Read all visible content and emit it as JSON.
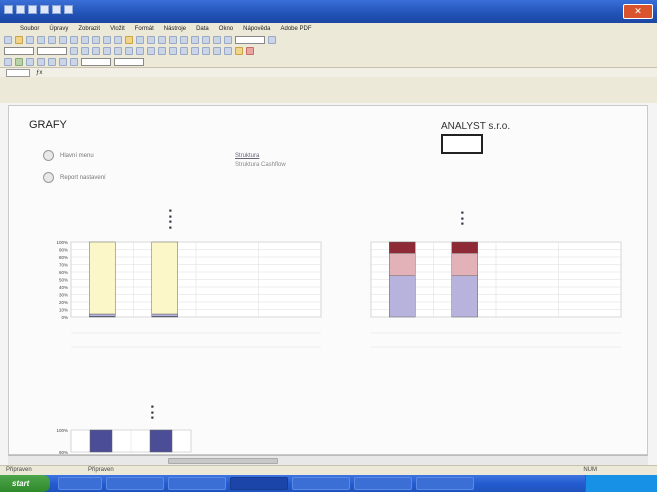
{
  "window": {
    "title": ""
  },
  "menu": {
    "items": [
      "Soubor",
      "Úpravy",
      "Zobrazit",
      "Vložit",
      "Formát",
      "Nástroje",
      "Data",
      "Okno",
      "Nápověda",
      "Adobe PDF"
    ],
    "help_hint": ""
  },
  "formula_bar": {
    "name_box": "",
    "value": ""
  },
  "sheet": {
    "title": "GRAFY",
    "company": "ANALYST s.r.o.",
    "radios": [
      "Hlavní menu",
      "Report nastavení"
    ],
    "links": [
      "Struktura",
      "Struktura Cashflow"
    ]
  },
  "status": {
    "left": "Připraven",
    "mid": "Připraven",
    "right": "NUM"
  },
  "taskbar": {
    "start": "start",
    "tasks": [
      "",
      "",
      "",
      "",
      "",
      ""
    ],
    "clock": ""
  },
  "colors": {
    "bar_yellow": "#fbf7c8",
    "bar_navy": "#4b4d97",
    "bar_red": "#8e2a36",
    "bar_lavender": "#b7b3dc",
    "bar_pink": "#e3b2b9"
  },
  "chart_data": [
    {
      "type": "bar",
      "title": "",
      "legend": [
        "",
        "",
        "",
        ""
      ],
      "yticks": [
        "100%",
        "90%",
        "80%",
        "70%",
        "60%",
        "50%",
        "40%",
        "30%",
        "20%",
        "10%",
        "0%"
      ],
      "ylim": [
        0,
        100
      ],
      "categories": [
        "",
        "",
        "",
        ""
      ],
      "category_sub1": [
        "",
        "",
        "",
        ""
      ],
      "category_sub2": [
        "",
        "",
        "",
        ""
      ],
      "series": [
        {
          "name": "",
          "values": [
            1,
            1,
            0,
            0
          ]
        },
        {
          "name": "",
          "values": [
            3,
            3,
            0,
            0
          ]
        },
        {
          "name": "",
          "values": [
            96,
            96,
            0,
            0
          ]
        }
      ]
    },
    {
      "type": "bar",
      "title": "",
      "legend": [
        "",
        "",
        ""
      ],
      "yticks": [
        "",
        "",
        "",
        "",
        "",
        "",
        "",
        "",
        "",
        "",
        ""
      ],
      "ylim": [
        0,
        100
      ],
      "categories": [
        "",
        "",
        "",
        ""
      ],
      "category_sub1": [
        "",
        "",
        "",
        ""
      ],
      "category_sub2": [
        "",
        "",
        "",
        ""
      ],
      "series": [
        {
          "name": "",
          "values": [
            55,
            55,
            0,
            0
          ]
        },
        {
          "name": "",
          "values": [
            30,
            30,
            0,
            0
          ]
        },
        {
          "name": "",
          "values": [
            15,
            15,
            0,
            0
          ]
        }
      ]
    },
    {
      "type": "bar",
      "title": "",
      "legend": [
        "",
        "",
        ""
      ],
      "yticks": [
        "100%",
        "90%"
      ],
      "ylim": [
        80,
        100
      ],
      "categories": [
        "",
        ""
      ],
      "series": [
        {
          "name": "",
          "values": [
            100,
            100
          ]
        }
      ]
    }
  ]
}
